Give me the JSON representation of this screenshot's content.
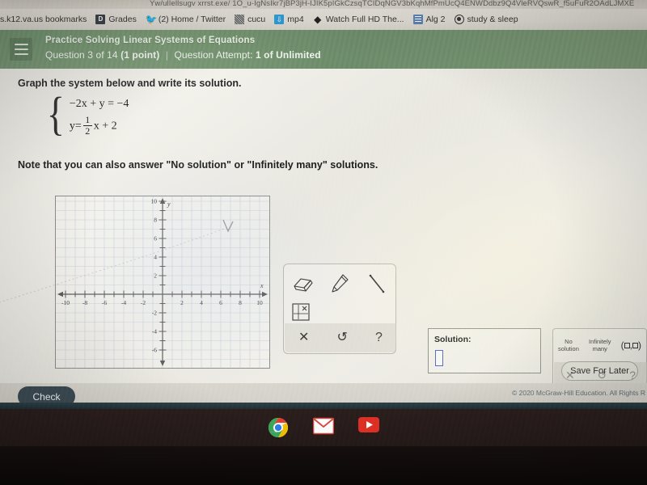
{
  "browser": {
    "url_text": "Yw/ulIellsugv xrrst.exe/ 1O_u-IgNsIkr7jBP3jH-IJIK5pIGkCzsqTCIDqNGV3bKqhMfPmUcQ4ENWDdbz9Q4VleRVQswR_f5uFuR2OAdLJMXE",
    "bookmarks": [
      {
        "label": "s.k12.va.us bookmarks",
        "icon": ""
      },
      {
        "label": "Grades",
        "icon": "grades-icon"
      },
      {
        "label": "(2) Home / Twitter",
        "icon": "twitter-icon"
      },
      {
        "label": "cucu",
        "icon": "cucu-icon"
      },
      {
        "label": "mp4",
        "icon": "mp4-icon"
      },
      {
        "label": "Watch Full HD The...",
        "icon": "diamond-icon"
      },
      {
        "label": "Alg 2",
        "icon": "document-icon"
      },
      {
        "label": "study & sleep",
        "icon": "circle-icon"
      }
    ]
  },
  "header": {
    "title": "Practice Solving Linear Systems of Equations",
    "question_label": "Question 3 of 14",
    "points": "(1 point)",
    "separator": "|",
    "attempt_label": "Question Attempt:",
    "attempt_value": "1 of Unlimited",
    "menu_icon": "hamburger-icon",
    "accent_color": "#72926d"
  },
  "question": {
    "prompt": "Graph the system below and write its solution.",
    "equation_1": {
      "lhs": "−2x + y",
      "eq": "=",
      "rhs": "−4",
      "full": "−2x + y = −4"
    },
    "equation_2": {
      "lhs": "y",
      "eq": "=",
      "fraction_num": "1",
      "fraction_den": "2",
      "tail": "x + 2",
      "full": "y = 1/2 x + 2"
    },
    "note": "Note that you can also answer \"No solution\" or \"Infinitely many\" solutions."
  },
  "graph": {
    "x_labels": [
      "-10",
      "-8",
      "-6",
      "-4",
      "-2",
      "2",
      "4",
      "6",
      "8",
      "10"
    ],
    "y_labels": [
      "10",
      "8",
      "6",
      "4",
      "2",
      "-2",
      "-4",
      "-6"
    ],
    "x_axis_name": "x",
    "y_axis_name": "y",
    "x_min": -11,
    "x_max": 11,
    "y_min": -7,
    "y_max": 11,
    "grid": true
  },
  "toolbar": {
    "tools": [
      {
        "name": "eraser-tool",
        "label": "Eraser"
      },
      {
        "name": "pencil-tool",
        "label": "Pencil"
      },
      {
        "name": "line-tool",
        "label": "Line"
      },
      {
        "name": "plot-point-tool",
        "label": "Plot point"
      }
    ],
    "clear_glyph": "✕",
    "undo_glyph": "↺",
    "help_glyph": "?"
  },
  "solution": {
    "label": "Solution:",
    "input_value": "",
    "input_placeholder": ""
  },
  "palette": {
    "no_solution_line1": "No",
    "no_solution_line2": "solution",
    "infinitely_line1": "Infinitely",
    "infinitely_line2": "many",
    "ordered_pair_open": "(",
    "ordered_pair_comma": ",",
    "ordered_pair_close": ")",
    "clear_glyph": "✕",
    "undo_glyph": "↺",
    "help_glyph": "?"
  },
  "actions": {
    "save_for_later": "Save For Later",
    "check": "Check"
  },
  "footer": {
    "copyright": "© 2020 McGraw-Hill Education. All Rights R"
  },
  "shelf": {
    "apps": [
      {
        "name": "chrome-icon",
        "label": "Chrome"
      },
      {
        "name": "gmail-icon",
        "label": "Gmail"
      },
      {
        "name": "youtube-icon",
        "label": "YouTube"
      }
    ]
  }
}
